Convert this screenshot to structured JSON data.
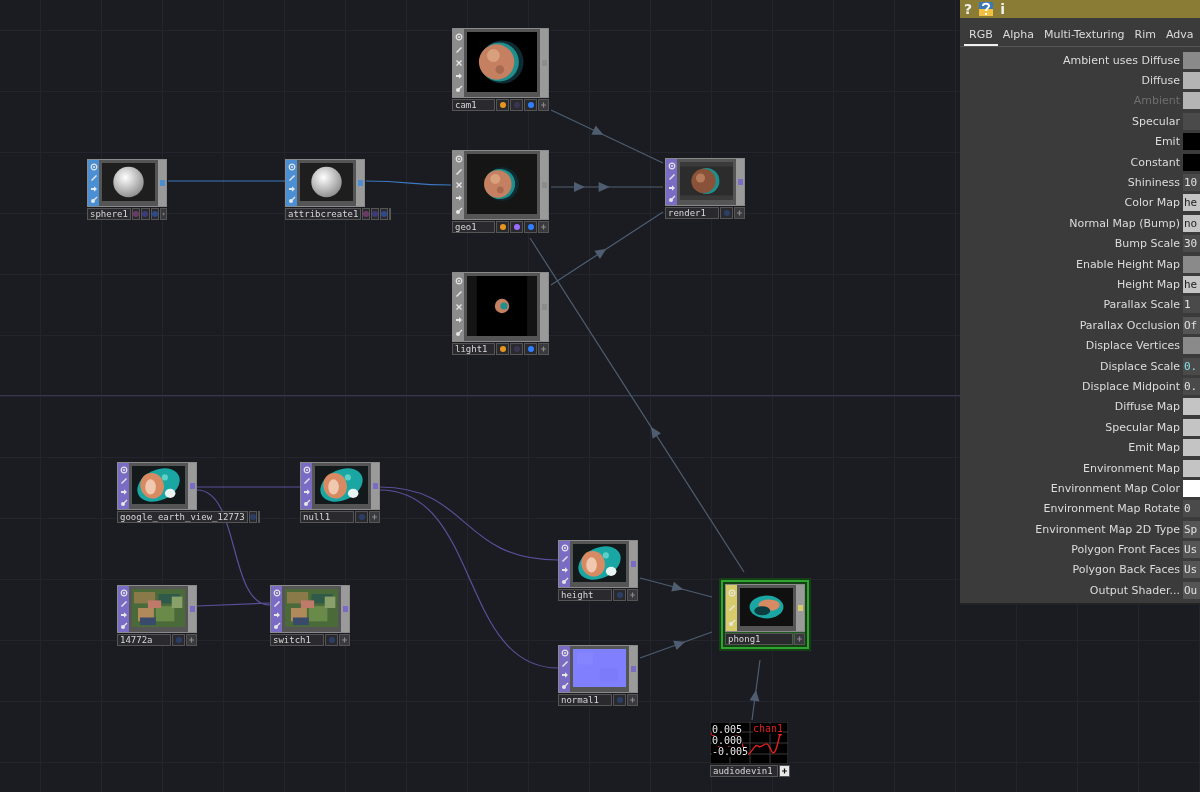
{
  "network": {
    "nodes": [
      {
        "name": "cam1",
        "kind": "comp",
        "selected": false,
        "flags": [
          {
            "color": "#e8961e"
          },
          {
            "color": "#3c3552"
          },
          {
            "color": "#2f7fff"
          }
        ]
      },
      {
        "name": "sphere1",
        "kind": "sop",
        "selected": false,
        "flags": [
          {
            "color": "#6a3a66"
          },
          {
            "color": "#3d3a78"
          },
          {
            "color": "#2a4a8a"
          }
        ]
      },
      {
        "name": "attribcreate1",
        "kind": "sop",
        "selected": false,
        "flags": [
          {
            "color": "#6a3a66"
          },
          {
            "color": "#3d3a78"
          },
          {
            "color": "#2a4a8a"
          }
        ]
      },
      {
        "name": "geo1",
        "kind": "comp",
        "selected": false,
        "flags": [
          {
            "color": "#e8961e"
          },
          {
            "color": "#9a6cff"
          },
          {
            "color": "#2f7fff"
          }
        ]
      },
      {
        "name": "render1",
        "kind": "top",
        "selected": false,
        "flags": [
          {
            "color": "#2b3f66"
          }
        ]
      },
      {
        "name": "light1",
        "kind": "comp",
        "selected": false,
        "flags": [
          {
            "color": "#e8961e"
          },
          {
            "color": "#3c3552"
          },
          {
            "color": "#2f7fff"
          }
        ]
      },
      {
        "name": "google_earth_view_12773",
        "kind": "top",
        "selected": false,
        "flags": [
          {
            "color": "#2b3f66"
          }
        ]
      },
      {
        "name": "null1",
        "kind": "top",
        "selected": false,
        "flags": [
          {
            "color": "#2b3f66"
          }
        ]
      },
      {
        "name": "height",
        "kind": "top",
        "selected": false,
        "flags": [
          {
            "color": "#2b3f66"
          }
        ]
      },
      {
        "name": "14772a",
        "kind": "top",
        "selected": false,
        "flags": [
          {
            "color": "#2b3f66"
          }
        ]
      },
      {
        "name": "switch1",
        "kind": "top",
        "selected": false,
        "flags": [
          {
            "color": "#2b3f66"
          }
        ]
      },
      {
        "name": "phong1",
        "kind": "mat",
        "selected": true
      },
      {
        "name": "normal1",
        "kind": "top",
        "selected": false,
        "flags": [
          {
            "color": "#2b3f66"
          }
        ]
      },
      {
        "name": "audiodevin1",
        "kind": "chop",
        "selected": false,
        "readouts": [
          "0.005",
          "0.000",
          "-0.005"
        ],
        "channel": "chan1"
      }
    ]
  },
  "parameters": {
    "header": {
      "help": "?",
      "info": "i"
    },
    "tabs": [
      {
        "label": "RGB",
        "selected": true
      },
      {
        "label": "Alpha",
        "selected": false
      },
      {
        "label": "Multi-Texturing",
        "selected": false
      },
      {
        "label": "Rim",
        "selected": false
      },
      {
        "label": "Adva",
        "selected": false
      }
    ],
    "rows": [
      {
        "label": "Ambient uses Diffuse",
        "kind": "toggle",
        "disabled": false
      },
      {
        "label": "Diffuse",
        "kind": "swatch",
        "color": "#b4b4b4",
        "disabled": false
      },
      {
        "label": "Ambient",
        "kind": "swatch",
        "color": "#b4b4b4",
        "disabled": true
      },
      {
        "label": "Specular",
        "kind": "swatch",
        "color": "#4a4a4a",
        "disabled": false
      },
      {
        "label": "Emit",
        "kind": "swatch",
        "color": "#000000",
        "disabled": false
      },
      {
        "label": "Constant",
        "kind": "swatch",
        "color": "#000000",
        "disabled": false
      },
      {
        "label": "Shininess",
        "kind": "number",
        "value": "10",
        "disabled": false
      },
      {
        "label": "Color Map",
        "kind": "path",
        "value": "he",
        "disabled": false
      },
      {
        "label": "Normal Map (Bump)",
        "kind": "path",
        "value": "no",
        "disabled": false
      },
      {
        "label": "Bump Scale",
        "kind": "number",
        "value": "30",
        "disabled": false
      },
      {
        "label": "Enable Height Map",
        "kind": "toggle",
        "disabled": false
      },
      {
        "label": "Height Map",
        "kind": "path",
        "value": "he",
        "disabled": false
      },
      {
        "label": "Parallax Scale",
        "kind": "number",
        "value": "1",
        "disabled": false
      },
      {
        "label": "Parallax Occlusion",
        "kind": "menu",
        "value": "Of",
        "disabled": false
      },
      {
        "label": "Displace Vertices",
        "kind": "toggle",
        "disabled": false
      },
      {
        "label": "Displace Scale",
        "kind": "expression",
        "value": "0.",
        "disabled": false
      },
      {
        "label": "Displace Midpoint",
        "kind": "number",
        "value": "0.",
        "disabled": false
      },
      {
        "label": "Diffuse Map",
        "kind": "path",
        "disabled": false
      },
      {
        "label": "Specular Map",
        "kind": "path",
        "disabled": false
      },
      {
        "label": "Emit Map",
        "kind": "path",
        "disabled": false
      },
      {
        "label": "Environment Map",
        "kind": "path",
        "disabled": false
      },
      {
        "label": "Environment Map Color",
        "kind": "swatch",
        "color": "#ffffff",
        "disabled": false
      },
      {
        "label": "Environment Map Rotate",
        "kind": "number",
        "value": "0",
        "disabled": false
      },
      {
        "label": "Environment Map 2D Type",
        "kind": "menu",
        "value": "Sp",
        "disabled": false
      },
      {
        "label": "Polygon Front Faces",
        "kind": "menu",
        "value": "Us",
        "disabled": false
      },
      {
        "label": "Polygon Back Faces",
        "kind": "menu",
        "value": "Us",
        "disabled": false
      },
      {
        "label": "Output Shader...",
        "kind": "menu",
        "value": "Ou",
        "disabled": false
      }
    ]
  }
}
